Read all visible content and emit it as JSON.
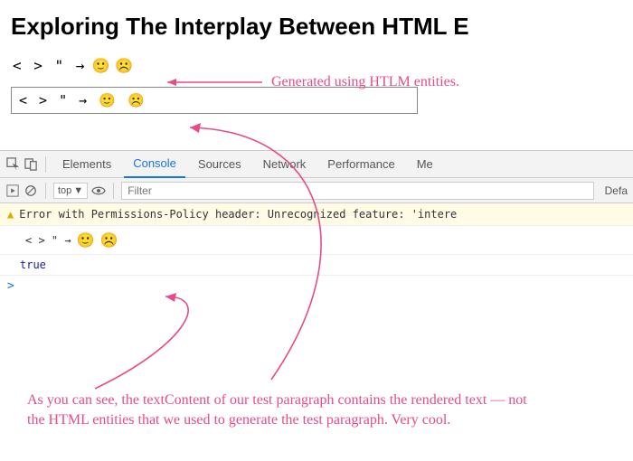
{
  "heading": "Exploring The Interplay Between HTML E",
  "entity_chars": "< > \" →",
  "emoji_neutral": "🙂",
  "emoji_frown": "☹️",
  "input_value": "< > \" → 🙂 ☹️",
  "annotation_top": "Generated using HTLM entities.",
  "annotation_bottom": "As you can see, the textContent of our test paragraph contains the rendered text — not the HTML entities that we used to generate the test paragraph. Very cool.",
  "devtools": {
    "tabs": {
      "elements": "Elements",
      "console": "Console",
      "sources": "Sources",
      "network": "Network",
      "performance": "Performance",
      "memory": "Me"
    },
    "toolbar": {
      "context": "top",
      "filter_placeholder": "Filter",
      "levels": "Defa"
    },
    "warning": "Error with Permissions-Policy header: Unrecognized feature: 'intere",
    "log_chars": "< > \" →",
    "log_true": "true",
    "prompt": ">"
  }
}
